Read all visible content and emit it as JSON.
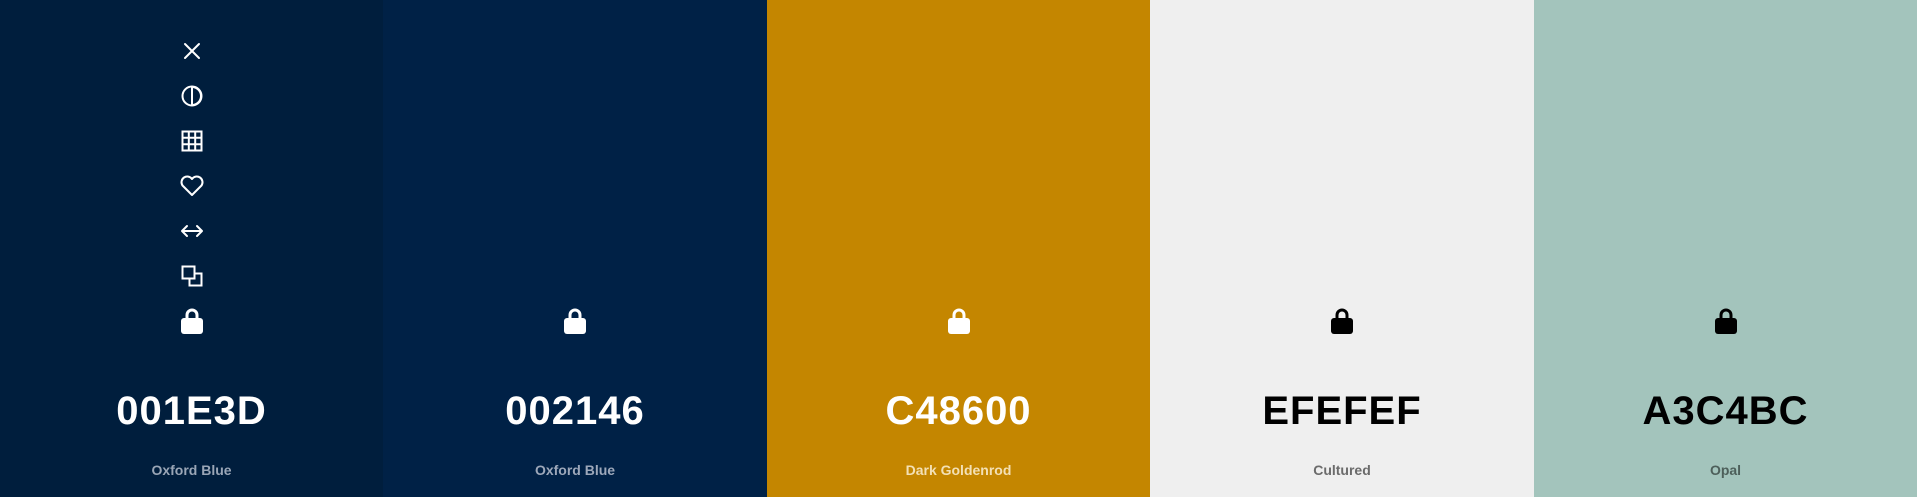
{
  "swatches": [
    {
      "hex": "001E3D",
      "name": "Oxford Blue",
      "bg": "#001E3D",
      "fg": "#FFFFFF",
      "name_color": "#9AA6B6"
    },
    {
      "hex": "002146",
      "name": "Oxford Blue",
      "bg": "#002146",
      "fg": "#FFFFFF",
      "name_color": "#9DA8BA"
    },
    {
      "hex": "C48600",
      "name": "Dark Goldenrod",
      "bg": "#C48600",
      "fg": "#FFFFFF",
      "name_color": "#F3E0B5"
    },
    {
      "hex": "EFEFEF",
      "name": "Cultured",
      "bg": "#EFEFEF",
      "fg": "#000000",
      "name_color": "#6B6B6B"
    },
    {
      "hex": "A3C4BC",
      "name": "Opal",
      "bg": "#A3C4BC",
      "fg": "#000000",
      "name_color": "#4D5F5A"
    }
  ],
  "toolbar": {
    "icons": [
      "close-icon",
      "contrast-icon",
      "grid-icon",
      "heart-icon",
      "arrows-horizontal-icon",
      "copy-icon"
    ]
  }
}
